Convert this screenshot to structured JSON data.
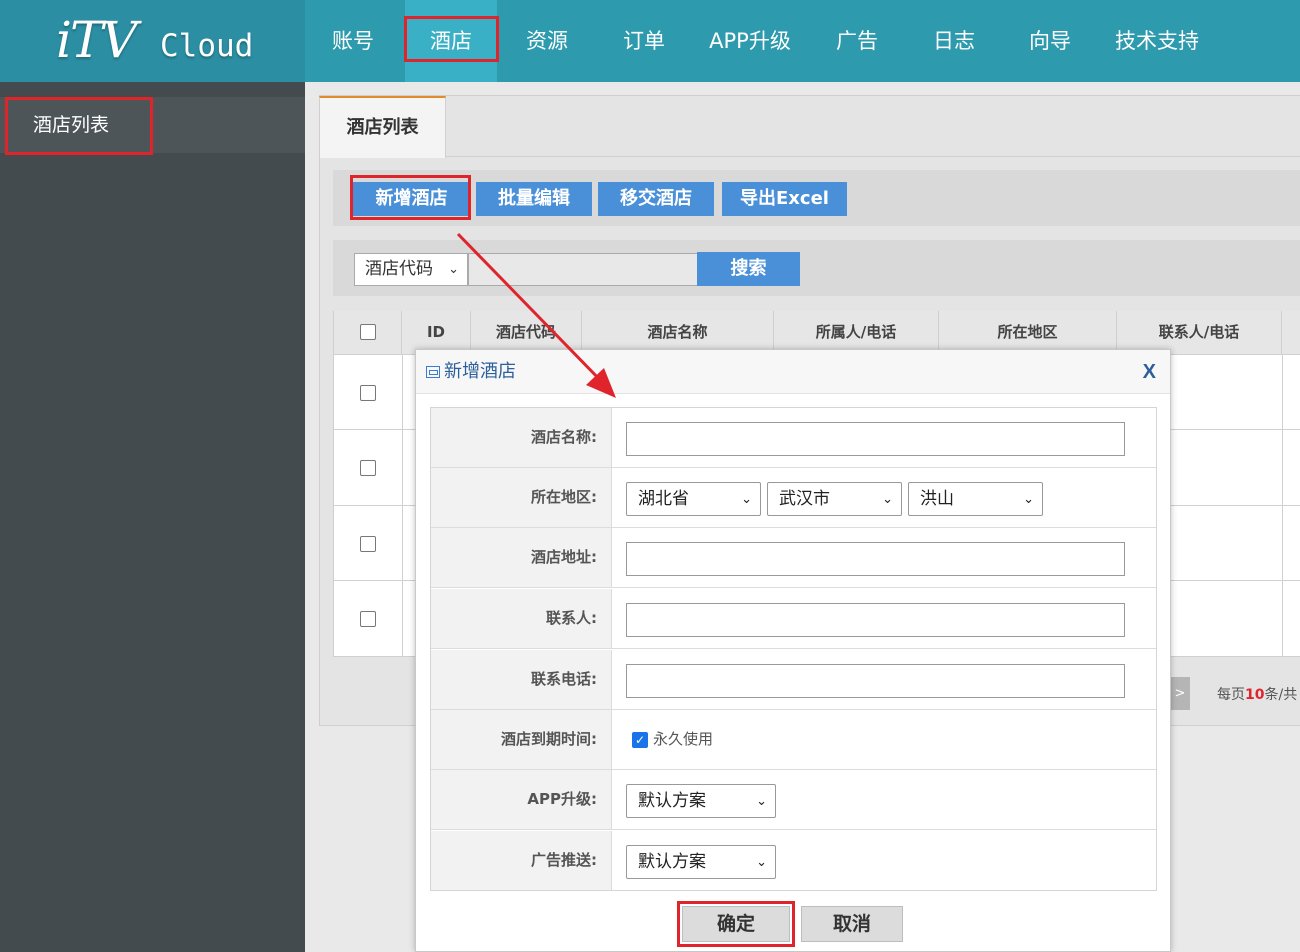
{
  "logo": {
    "brand": "iTV",
    "product": "Cloud"
  },
  "nav": [
    "账号",
    "酒店",
    "资源",
    "订单",
    "APP升级",
    "广告",
    "日志",
    "向导",
    "技术支持"
  ],
  "sidebar": {
    "item": "酒店列表"
  },
  "tab": {
    "label": "酒店列表"
  },
  "toolbar": {
    "add": "新增酒店",
    "batch_edit": "批量编辑",
    "transfer": "移交酒店",
    "export": "导出Excel"
  },
  "search": {
    "field": "酒店代码",
    "button": "搜索",
    "value": ""
  },
  "table": {
    "headers": [
      "ID",
      "酒店代码",
      "酒店名称",
      "所属人/电话",
      "所在地区",
      "联系人/电话"
    ]
  },
  "pagination": {
    "next": ">",
    "per_page_prefix": "每页",
    "per_page": "10",
    "per_page_suffix": "条/共"
  },
  "modal": {
    "title": "新增酒店",
    "close": "X",
    "fields": {
      "name": {
        "label": "酒店名称:",
        "value": ""
      },
      "region": {
        "label": "所在地区:",
        "province": "湖北省",
        "city": "武汉市",
        "district": "洪山"
      },
      "address": {
        "label": "酒店地址:",
        "value": ""
      },
      "contact": {
        "label": "联系人:",
        "value": ""
      },
      "phone": {
        "label": "联系电话:",
        "value": ""
      },
      "expiry": {
        "label": "酒店到期时间:",
        "checkbox": "永久使用",
        "checked": true
      },
      "app_upgrade": {
        "label": "APP升级:",
        "value": "默认方案"
      },
      "ad_push": {
        "label": "广告推送:",
        "value": "默认方案"
      }
    },
    "ok": "确定",
    "cancel": "取消"
  },
  "colors": {
    "topbar": "#2e9aae",
    "sidebar": "#434b4e",
    "primary_button": "#4a90d9",
    "highlight": "#e0242b"
  }
}
